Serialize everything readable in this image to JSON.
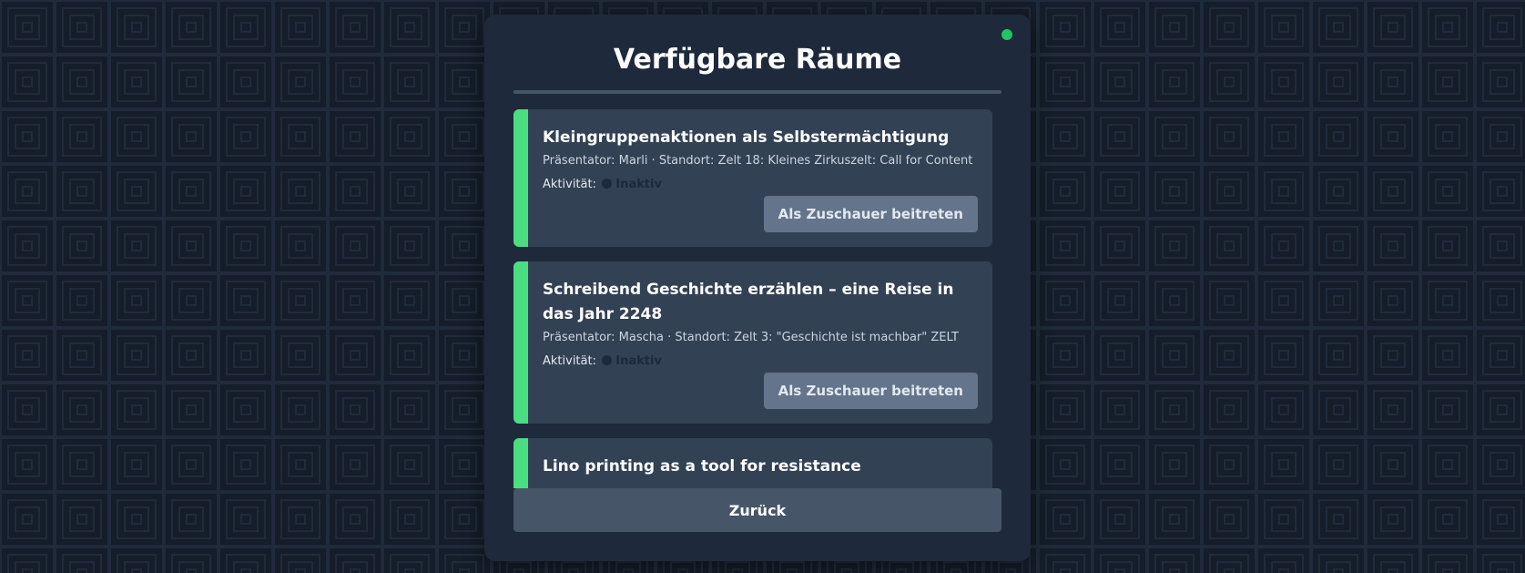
{
  "colors": {
    "background": "#141d29",
    "modal": "#1e293b",
    "card": "#334155",
    "accent_green": "#4ade80",
    "status_online": "#22c55e",
    "button": "#64748b",
    "back_button": "#475569"
  },
  "modal": {
    "title": "Verfügbare Räume",
    "status": "online",
    "back_label": "Zurück"
  },
  "rooms": [
    {
      "title": "Kleingruppenaktionen als Selbstermächtigung",
      "meta": "Präsentator: Marli · Standort: Zelt 18: Kleines Zirkuszelt: Call for Content",
      "activity_label": "Aktivität:",
      "activity_state": "Inaktiv",
      "join_label": "Als Zuschauer beitreten"
    },
    {
      "title": "Schreibend Geschichte erzählen – eine Reise in das Jahr 2248",
      "meta": "Präsentator: Mascha · Standort: Zelt 3: \"Geschichte ist machbar\" ZELT",
      "activity_label": "Aktivität:",
      "activity_state": "Inaktiv",
      "join_label": "Als Zuschauer beitreten"
    },
    {
      "title": "Lino printing as a tool for resistance"
    }
  ]
}
